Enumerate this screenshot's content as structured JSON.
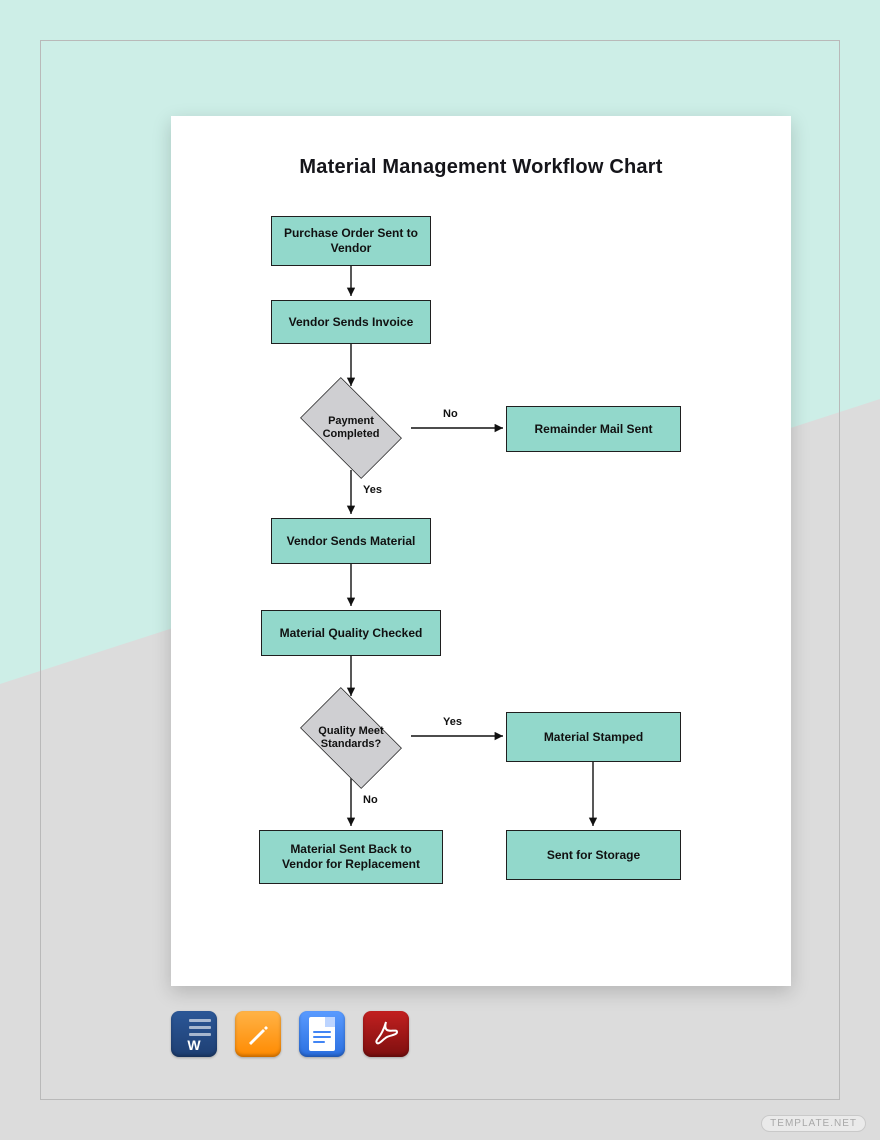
{
  "title": "Material Management Workflow Chart",
  "nodes": {
    "n1": "Purchase Order Sent to Vendor",
    "n2": "Vendor Sends Invoice",
    "d1": "Payment Completed",
    "n3": "Remainder Mail Sent",
    "n4": "Vendor Sends Material",
    "n5": "Material Quality Checked",
    "d2": "Quality Meet Standards?",
    "n6": "Material Stamped",
    "n7": "Material Sent Back to Vendor for Replacement",
    "n8": "Sent for Storage"
  },
  "labels": {
    "yes": "Yes",
    "no": "No"
  },
  "formats": [
    {
      "name": "word",
      "letter": "W",
      "color1": "#2b5797",
      "color2": "#1e3f73"
    },
    {
      "name": "pages",
      "letter": "",
      "color1": "#ff9d2f",
      "color2": "#ff7a00"
    },
    {
      "name": "google-docs",
      "letter": "",
      "color1": "#4285f4",
      "color2": "#1a63d8"
    },
    {
      "name": "pdf",
      "letter": "",
      "color1": "#b51d1d",
      "color2": "#7d0f0f"
    }
  ],
  "watermark": "TEMPLATE.NET"
}
